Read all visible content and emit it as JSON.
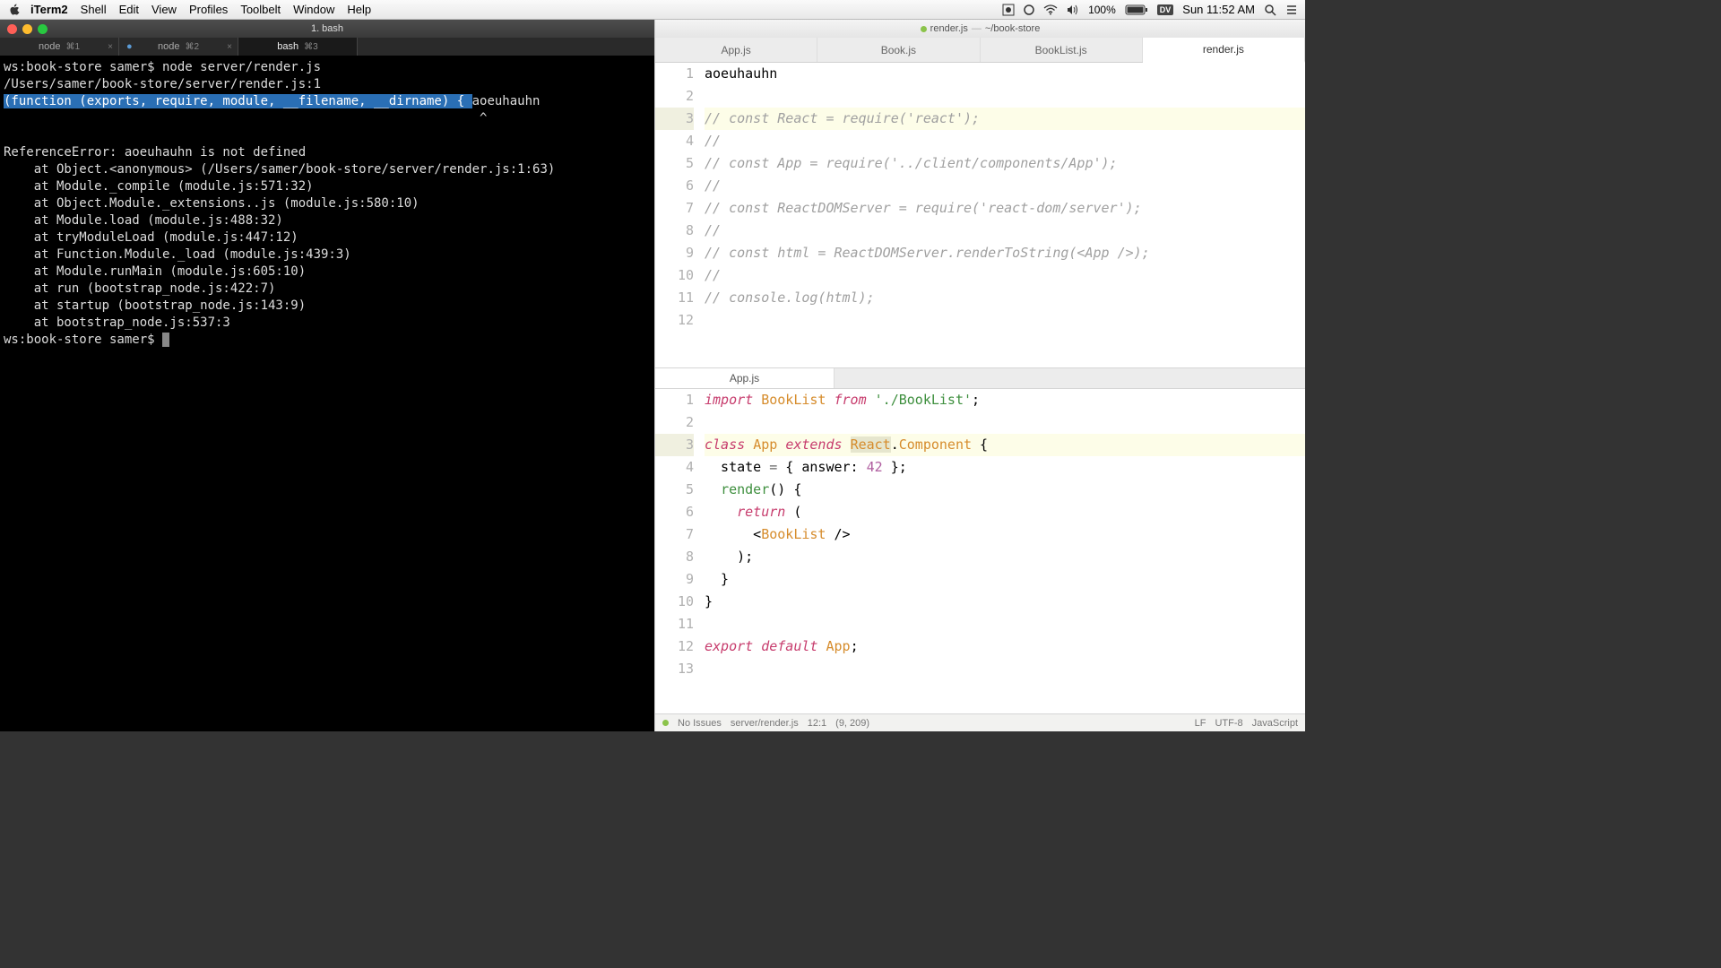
{
  "menubar": {
    "app": "iTerm2",
    "items": [
      "Shell",
      "Edit",
      "View",
      "Profiles",
      "Toolbelt",
      "Window",
      "Help"
    ],
    "battery": "100%",
    "clock": "Sun 11:52 AM"
  },
  "terminal": {
    "title": "1. bash",
    "tabs": [
      {
        "name": "node",
        "key": "⌘1",
        "close": "×"
      },
      {
        "name": "node",
        "key": "⌘2",
        "close": "×",
        "mod": true
      },
      {
        "name": "bash",
        "key": "⌘3",
        "close": "",
        "active": true
      }
    ],
    "lines": [
      {
        "t": "ws:book-store samer$ node server/render.js"
      },
      {
        "t": "/Users/samer/book-store/server/render.js:1"
      },
      {
        "seg": [
          {
            "t": "(function (exports, require, module, __filename, __dirname) { ",
            "hl": true
          },
          {
            "t": "aoeuhauhn"
          }
        ]
      },
      {
        "t": "                                                               ^"
      },
      {
        "t": ""
      },
      {
        "t": "ReferenceError: aoeuhauhn is not defined"
      },
      {
        "t": "    at Object.<anonymous> (/Users/samer/book-store/server/render.js:1:63)"
      },
      {
        "t": "    at Module._compile (module.js:571:32)"
      },
      {
        "t": "    at Object.Module._extensions..js (module.js:580:10)"
      },
      {
        "t": "    at Module.load (module.js:488:32)"
      },
      {
        "t": "    at tryModuleLoad (module.js:447:12)"
      },
      {
        "t": "    at Function.Module._load (module.js:439:3)"
      },
      {
        "t": "    at Module.runMain (module.js:605:10)"
      },
      {
        "t": "    at run (bootstrap_node.js:422:7)"
      },
      {
        "t": "    at startup (bootstrap_node.js:143:9)"
      },
      {
        "t": "    at bootstrap_node.js:537:3"
      },
      {
        "seg": [
          {
            "t": "ws:book-store samer$ "
          },
          {
            "cursor": true
          }
        ]
      }
    ]
  },
  "editor": {
    "title_file": "render.js",
    "title_path": "~/book-store",
    "tabs": [
      "App.js",
      "Book.js",
      "BookList.js",
      "render.js"
    ],
    "active_tab": 3,
    "top_code": [
      {
        "n": 1,
        "html": "aoeuhauhn"
      },
      {
        "n": 2,
        "html": ""
      },
      {
        "n": 3,
        "hl": true,
        "html": "<span class='cm'>// const React = require('react');</span>"
      },
      {
        "n": 4,
        "html": "<span class='cm'>//</span>"
      },
      {
        "n": 5,
        "html": "<span class='cm'>// const App = require('../client/components/App');</span>"
      },
      {
        "n": 6,
        "html": "<span class='cm'>//</span>"
      },
      {
        "n": 7,
        "html": "<span class='cm'>// const ReactDOMServer = require('react-dom/server');</span>"
      },
      {
        "n": 8,
        "html": "<span class='cm'>//</span>"
      },
      {
        "n": 9,
        "html": "<span class='cm'>// const html = ReactDOMServer.renderToString(&lt;App /&gt;);</span>"
      },
      {
        "n": 10,
        "html": "<span class='cm'>//</span>"
      },
      {
        "n": 11,
        "html": "<span class='cm'>// console.log(html);</span>"
      },
      {
        "n": 12,
        "html": ""
      }
    ],
    "split_tab": "App.js",
    "bottom_code": [
      {
        "n": 1,
        "html": "<span class='kw2'>import</span> <span class='cls'>BookList</span> <span class='kw2'>from</span> <span class='str'>'./BookList'</span>;"
      },
      {
        "n": 2,
        "html": ""
      },
      {
        "n": 3,
        "hl": true,
        "html": "<span class='kw2'>class</span> <span class='cls'>App</span> <span class='kw2'>extends</span> <span class='cls react-hl'>React</span>.<span class='cls'>Component</span> {"
      },
      {
        "n": 4,
        "html": "  state <span class='op'>=</span> { answer: <span class='num'>42</span> };"
      },
      {
        "n": 5,
        "html": "  <span class='fn'>render</span>() {"
      },
      {
        "n": 6,
        "html": "    <span class='kw2'>return</span> ("
      },
      {
        "n": 7,
        "html": "      &lt;<span class='jsx'>BookList</span> /&gt;"
      },
      {
        "n": 8,
        "html": "    );"
      },
      {
        "n": 9,
        "html": "  }"
      },
      {
        "n": 10,
        "html": "}"
      },
      {
        "n": 11,
        "html": ""
      },
      {
        "n": 12,
        "html": "<span class='kw2'>export</span> <span class='kw2'>default</span> <span class='cls'>App</span>;"
      },
      {
        "n": 13,
        "html": ""
      }
    ],
    "status": {
      "issues": "No Issues",
      "path": "server/render.js",
      "pos": "12:1",
      "sel": "(9, 209)",
      "eol": "LF",
      "enc": "UTF-8",
      "lang": "JavaScript"
    }
  }
}
